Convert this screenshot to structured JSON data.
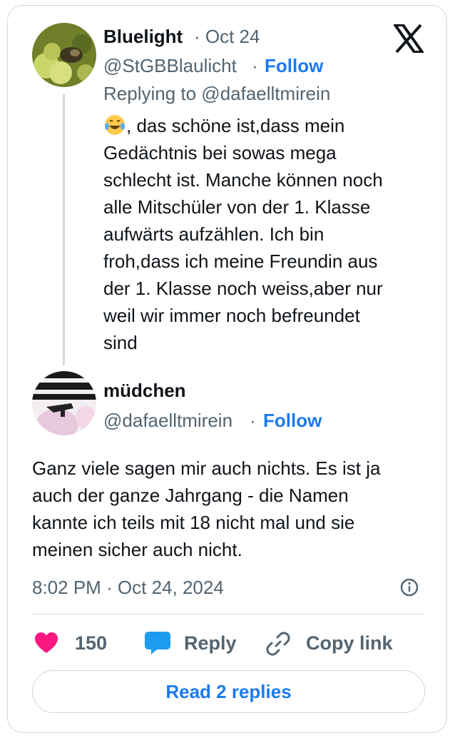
{
  "parent_tweet": {
    "display_name": "Bluelight",
    "date": "· Oct 24",
    "handle": "@StGBBlaulicht",
    "separator": "·",
    "follow_label": "Follow",
    "replying_to": "Replying to @dafaelltmirein",
    "emoji": "😂",
    "text": ", das schöne ist,dass mein\nGedächtnis bei sowas mega\nschlecht ist. Manche können noch\nalle Mitschüler von der 1. Klasse\naufwärts aufzählen. Ich bin\nfroh,dass ich meine Freundin aus\nder 1. Klasse noch weiss,aber nur\nweil wir immer noch befreundet\nsind"
  },
  "main_tweet": {
    "display_name": "müdchen",
    "handle": "@dafaelltmirein",
    "separator": "·",
    "follow_label": "Follow",
    "text": "Ganz viele sagen mir auch nichts. Es ist ja\nauch der ganze Jahrgang - die Namen\nkannte ich teils mit 18 nicht mal und sie\nmeinen sicher auch nicht.",
    "timestamp": "8:02 PM · Oct 24, 2024"
  },
  "actions": {
    "like_count": "150",
    "reply_label": "Reply",
    "copy_link_label": "Copy link"
  },
  "read_replies_label": "Read 2 replies",
  "colors": {
    "accent": "#1d7af0",
    "like": "#f91880",
    "muted": "#536471",
    "border": "#cfd9de"
  },
  "icons": [
    "x-logo-icon",
    "heart-icon",
    "speech-bubble-icon",
    "link-icon",
    "info-icon"
  ]
}
